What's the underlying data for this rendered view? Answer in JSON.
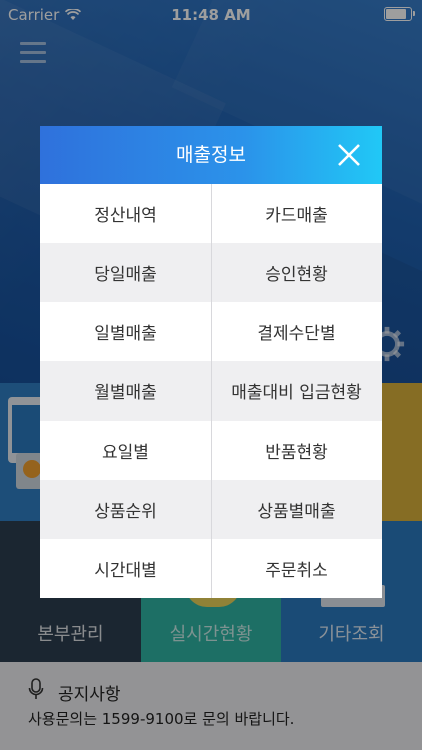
{
  "status_bar": {
    "carrier": "Carrier",
    "time": "11:48 AM",
    "battery_level": 0.9
  },
  "modal": {
    "title": "매출정보",
    "rows": [
      {
        "left": "정산내역",
        "right": "카드매출"
      },
      {
        "left": "당일매출",
        "right": "승인현황"
      },
      {
        "left": "일별매출",
        "right": "결제수단별"
      },
      {
        "left": "월별매출",
        "right": "매출대비 입금현황"
      },
      {
        "left": "요일별",
        "right": "반품현황"
      },
      {
        "left": "상품순위",
        "right": "상품별매출"
      },
      {
        "left": "시간대별",
        "right": "주문취소"
      }
    ]
  },
  "tiles": [
    {
      "label": "본부관리",
      "color": "#2c3e50"
    },
    {
      "label": "실시간현황",
      "color": "#2fb4a4"
    },
    {
      "label": "기타조회",
      "color": "#2b79bf"
    }
  ],
  "tile_colors": {
    "left_mid": "#2f7fc4",
    "right_mid": "#d9b13a"
  },
  "notice": {
    "title": "공지사항",
    "body": "사용문의는 1599-9100로 문의 바랍니다."
  }
}
